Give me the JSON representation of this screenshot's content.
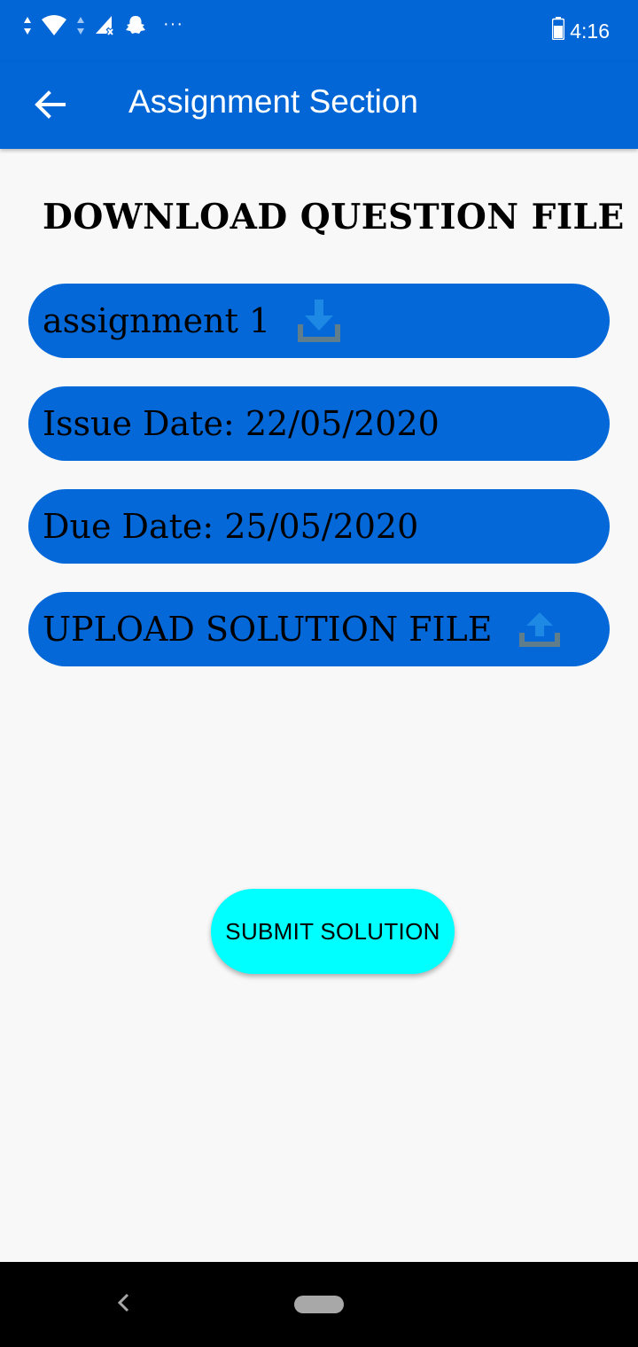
{
  "status_bar": {
    "time": "4:16",
    "more_indicator": "···",
    "icons": [
      "data-arrows-icon",
      "wifi-icon",
      "data-arrows-icon",
      "signal-off-icon",
      "snapchat-icon",
      "battery-icon"
    ]
  },
  "app_bar": {
    "title": "Assignment Section",
    "back_icon": "arrow-left-icon"
  },
  "main": {
    "heading": "DOWNLOAD QUESTION FILE",
    "assignment_name": "assignment 1",
    "issue_date": "Issue Date: 22/05/2020",
    "due_date": "Due Date: 25/05/2020",
    "upload_label": "UPLOAD SOLUTION FILE",
    "submit_label": "SUBMIT SOLUTION"
  },
  "colors": {
    "primary": "#0366d6",
    "pill": "#0468d8",
    "accent": "#00ffff",
    "icon_arrow": "#1e88e5",
    "icon_tray": "#607d8b"
  }
}
